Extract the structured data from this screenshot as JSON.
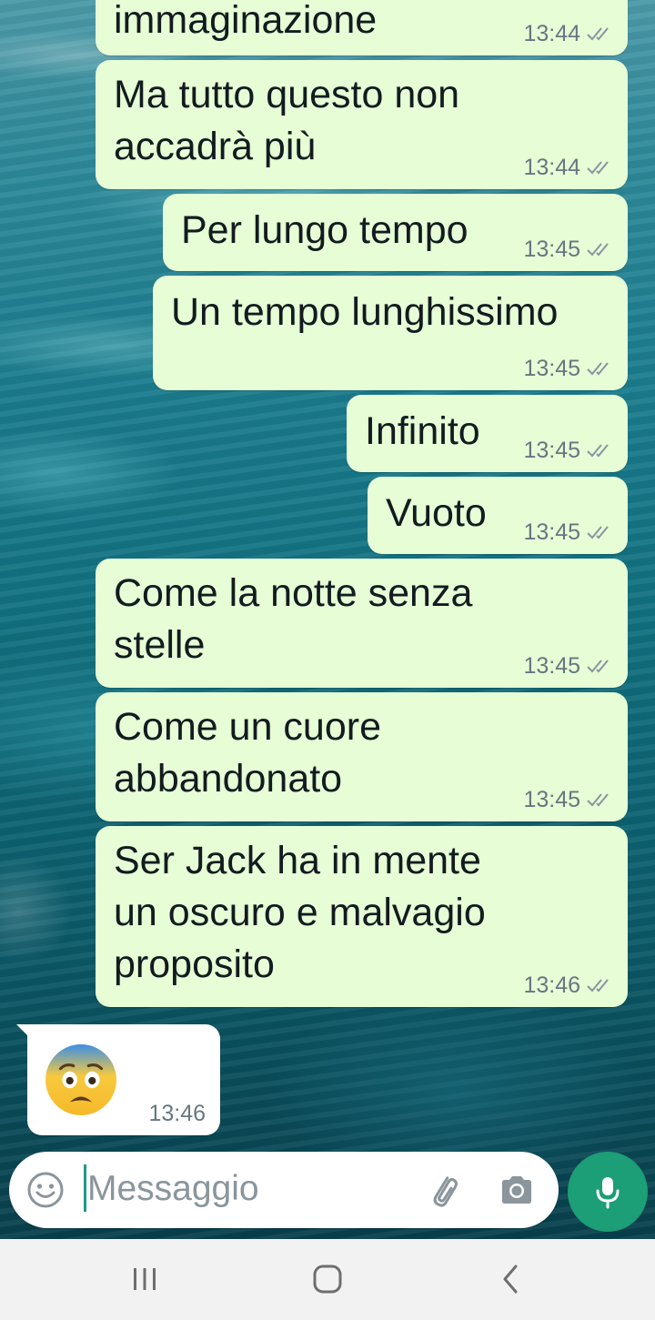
{
  "messages": [
    {
      "text": [
        "immaginazione"
      ],
      "time": "13:44",
      "direction": "out",
      "read": true
    },
    {
      "text": [
        "Ma tutto questo non",
        "accadrà più"
      ],
      "time": "13:44",
      "direction": "out",
      "read": true
    },
    {
      "text": [
        "Per lungo tempo"
      ],
      "time": "13:45",
      "direction": "out",
      "read": true
    },
    {
      "text": [
        "Un tempo lunghissimo"
      ],
      "time": "13:45",
      "direction": "out",
      "read": true
    },
    {
      "text": [
        "Infinito"
      ],
      "time": "13:45",
      "direction": "out",
      "read": true
    },
    {
      "text": [
        "Vuoto"
      ],
      "time": "13:45",
      "direction": "out",
      "read": true
    },
    {
      "text": [
        "Come la notte senza",
        "stelle"
      ],
      "time": "13:45",
      "direction": "out",
      "read": true
    },
    {
      "text": [
        "Come un cuore",
        "abbandonato"
      ],
      "time": "13:45",
      "direction": "out",
      "read": true
    },
    {
      "text": [
        "Ser Jack ha in mente",
        "un oscuro e malvagio",
        "proposito"
      ],
      "time": "13:46",
      "direction": "out",
      "read": true
    },
    {
      "emoji": "😨",
      "time": "13:46",
      "direction": "in"
    }
  ],
  "composer": {
    "placeholder": "Messaggio",
    "value": ""
  },
  "icons": {
    "emoji": "smiley-icon",
    "attach": "paperclip-icon",
    "camera": "camera-icon",
    "mic": "microphone-icon",
    "read_receipt": "double-check-icon",
    "nav_recents": "recent-apps-icon",
    "nav_home": "home-icon",
    "nav_back": "back-icon"
  },
  "colors": {
    "outgoing_bubble": "#e6fdd6",
    "incoming_bubble": "#ffffff",
    "accent_green": "#1c9e76",
    "timestamp": "#667781"
  }
}
